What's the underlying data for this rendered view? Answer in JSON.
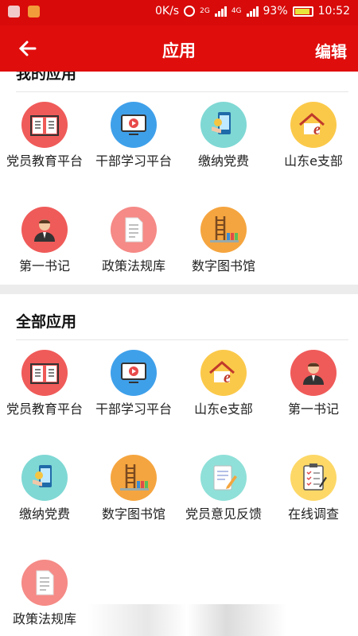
{
  "status_bar": {
    "speed": "0K/s",
    "net1": "2G",
    "net2": "4G",
    "battery": "93%",
    "time": "10:52"
  },
  "appbar": {
    "back_icon": "arrow-left-icon",
    "title": "应用",
    "edit": "编辑"
  },
  "my_apps": {
    "title": "我的应用",
    "items": [
      {
        "label": "党员教育平台",
        "icon": "book-icon"
      },
      {
        "label": "干部学习平台",
        "icon": "monitor-play-icon"
      },
      {
        "label": "缴纳党费",
        "icon": "phone-payment-icon"
      },
      {
        "label": "山东e支部",
        "icon": "house-e-icon"
      },
      {
        "label": "第一书记",
        "icon": "person-icon"
      },
      {
        "label": "政策法规库",
        "icon": "document-icon"
      },
      {
        "label": "数字图书馆",
        "icon": "library-shelf-icon"
      }
    ]
  },
  "all_apps": {
    "title": "全部应用",
    "items": [
      {
        "label": "党员教育平台",
        "icon": "book-icon"
      },
      {
        "label": "干部学习平台",
        "icon": "monitor-play-icon"
      },
      {
        "label": "山东e支部",
        "icon": "house-e-icon"
      },
      {
        "label": "第一书记",
        "icon": "person-icon"
      },
      {
        "label": "缴纳党费",
        "icon": "phone-payment-icon"
      },
      {
        "label": "数字图书馆",
        "icon": "library-shelf-icon"
      },
      {
        "label": "党员意见反馈",
        "icon": "notepad-pen-icon"
      },
      {
        "label": "在线调查",
        "icon": "clipboard-check-icon"
      },
      {
        "label": "政策法规库",
        "icon": "document-icon"
      }
    ]
  }
}
